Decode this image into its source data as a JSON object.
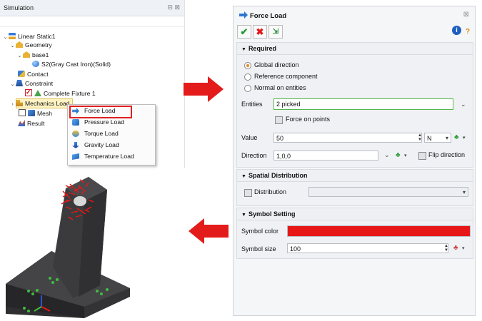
{
  "simulation_panel": {
    "title": "Simulation",
    "header_icons": "⊟ ⊠",
    "tree": {
      "linear_static": "Linear Static1",
      "geometry": "Geometry",
      "base": "base1",
      "part": "S2(Gray Cast Iron)(Solid)",
      "contact": "Contact",
      "constraint": "Constraint",
      "fixture": "Complete Fixture 1",
      "mechanics_loads": "Mechanics Lo",
      "mechanics_loads_tail": "ad",
      "mesh": "Mesh",
      "result": "Result"
    },
    "context_menu": [
      {
        "label": "Force Load",
        "icon": "force-load-icon"
      },
      {
        "label": "Pressure Load",
        "icon": "pressure-load-icon"
      },
      {
        "label": "Torque Load",
        "icon": "torque-load-icon"
      },
      {
        "label": "Gravity Load",
        "icon": "gravity-load-icon"
      },
      {
        "label": "Temperature Load",
        "icon": "temperature-load-icon"
      }
    ]
  },
  "dialog": {
    "title": "Force Load",
    "close_glyph": "⊠",
    "toolbar": {
      "ok": "✔",
      "cancel": "✖",
      "apply": "⇲",
      "info": "i",
      "help": "?"
    },
    "required": {
      "header": "Required",
      "options": [
        "Global direction",
        "Reference component",
        "Normal on entities"
      ],
      "selected_option": "Global direction",
      "entities_label": "Entities",
      "entities_value": "2 picked",
      "force_on_points_label": "Force on points",
      "value_label": "Value",
      "value": "50",
      "unit": "N",
      "direction_label": "Direction",
      "direction_value": "1,0,0",
      "flip_direction_label": "Flip direction"
    },
    "spatial": {
      "header": "Spatial Distribution",
      "distribution_label": "Distribution",
      "distribution_value": ""
    },
    "symbol": {
      "header": "Symbol Setting",
      "color_label": "Symbol color",
      "color_value": "#e81717",
      "size_label": "Symbol size",
      "size_value": "100"
    }
  },
  "colors": {
    "arrow": "#e31b1b",
    "highlight_box": "#e02020",
    "model_body": "#3b3b3d",
    "load_symbols": "#e81717",
    "fixture_symbols": "#3fbf3f"
  }
}
